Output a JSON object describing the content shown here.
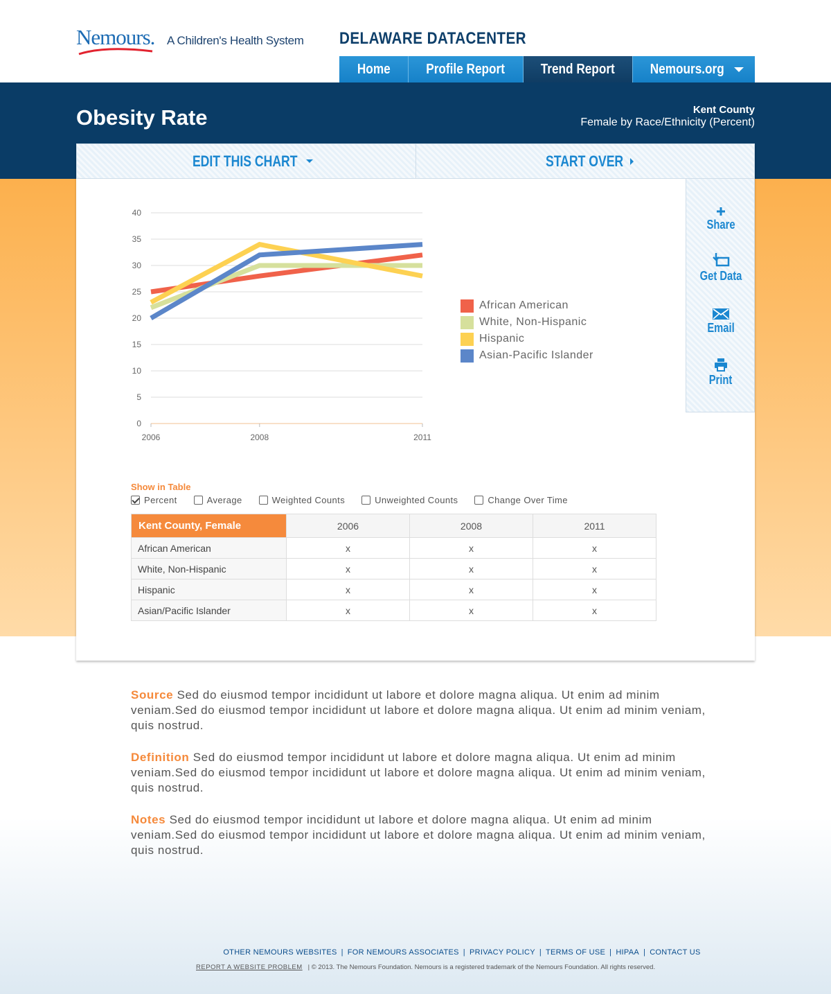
{
  "header": {
    "logo_text": "Nemours.",
    "tagline": "A Children's Health System",
    "site_title": "DELAWARE DATACENTER"
  },
  "nav": [
    {
      "label": "Home",
      "active": false
    },
    {
      "label": "Profile Report",
      "active": false
    },
    {
      "label": "Trend Report",
      "active": true
    },
    {
      "label": "Nemours.org",
      "active": false
    }
  ],
  "page": {
    "title": "Obesity Rate",
    "county": "Kent County",
    "subtitle": "Female by Race/Ethnicity (Percent)"
  },
  "toolbar": {
    "edit_label": "EDIT THIS CHART",
    "start_over_label": "START OVER"
  },
  "side_actions": [
    {
      "label": "Share",
      "icon": "plus-icon"
    },
    {
      "label": "Get Data",
      "icon": "download-data-icon"
    },
    {
      "label": "Email",
      "icon": "envelope-icon"
    },
    {
      "label": "Print",
      "icon": "printer-icon"
    }
  ],
  "chart_data": {
    "type": "line",
    "x": [
      "2006",
      "2008",
      "2011"
    ],
    "ylim": [
      0,
      40
    ],
    "yticks": [
      0,
      5,
      10,
      15,
      20,
      25,
      30,
      35,
      40
    ],
    "grid": true,
    "legend_position": "right",
    "series": [
      {
        "name": "African American",
        "color": "#f0624a",
        "values": [
          25,
          28,
          32
        ]
      },
      {
        "name": "White, Non-Hispanic",
        "color": "#d6e09c",
        "values": [
          22,
          30,
          30
        ]
      },
      {
        "name": "Hispanic",
        "color": "#fdd152",
        "values": [
          23,
          34,
          28
        ]
      },
      {
        "name": "Asian-Pacific Islander",
        "color": "#5b86c9",
        "values": [
          20,
          32,
          34
        ]
      }
    ]
  },
  "table_options": {
    "label": "Show in Table",
    "options": [
      {
        "label": "Percent",
        "checked": true
      },
      {
        "label": "Average",
        "checked": false
      },
      {
        "label": "Weighted Counts",
        "checked": false
      },
      {
        "label": "Unweighted Counts",
        "checked": false
      },
      {
        "label": "Change Over Time",
        "checked": false
      }
    ]
  },
  "table": {
    "corner": "Kent County, Female",
    "columns": [
      "2006",
      "2008",
      "2011"
    ],
    "rows": [
      {
        "label": "African American",
        "values": [
          "x",
          "x",
          "x"
        ]
      },
      {
        "label": "White, Non-Hispanic",
        "values": [
          "x",
          "x",
          "x"
        ]
      },
      {
        "label": "Hispanic",
        "values": [
          "x",
          "x",
          "x"
        ]
      },
      {
        "label": "Asian/Pacific Islander",
        "values": [
          "x",
          "x",
          "x"
        ]
      }
    ]
  },
  "notes": [
    {
      "key": "Source",
      "text": "Sed do eiusmod tempor incididunt ut labore et dolore magna aliqua. Ut enim ad minim veniam.Sed do eiusmod tempor incididunt ut labore et dolore magna aliqua. Ut enim ad minim veniam, quis nostrud."
    },
    {
      "key": "Definition",
      "text": "Sed do eiusmod tempor incididunt ut labore et dolore magna aliqua. Ut enim ad minim veniam.Sed do eiusmod tempor incididunt ut labore et dolore magna aliqua. Ut enim ad minim veniam, quis nostrud."
    },
    {
      "key": "Notes",
      "text": "Sed do eiusmod tempor incididunt ut labore et dolore magna aliqua. Ut enim ad minim veniam.Sed do eiusmod tempor incididunt ut labore et dolore magna aliqua. Ut enim ad minim veniam, quis nostrud."
    }
  ],
  "footer": {
    "links": [
      "OTHER NEMOURS WEBSITES",
      "FOR NEMOURS ASSOCIATES",
      "PRIVACY POLICY",
      "TERMS OF USE",
      "HIPAA",
      "CONTACT US"
    ],
    "report_link": "REPORT A WEBSITE PROBLEM",
    "copyright": "|  © 2013. The Nemours Foundation. Nemours is a registered trademark of the Nemours Foundation. All rights reserved."
  }
}
